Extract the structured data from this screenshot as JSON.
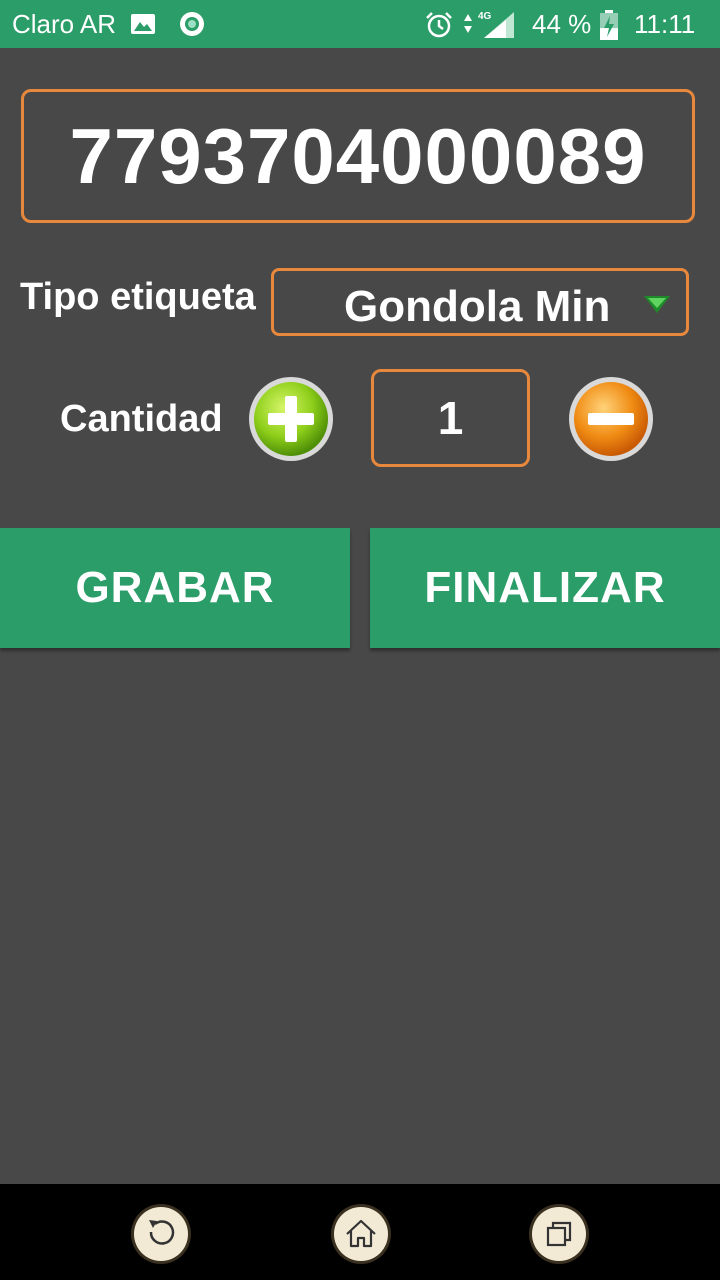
{
  "status_bar": {
    "carrier": "Claro AR",
    "network": "4G",
    "battery_percent": "44 %",
    "battery_level": 0.44,
    "time": "11:11",
    "icons": [
      "image-icon",
      "record-circle-icon",
      "alarm-icon",
      "data-signal-icon",
      "battery-charging-icon"
    ]
  },
  "barcode": {
    "value": "7793704000089"
  },
  "tipo_etiqueta": {
    "label": "Tipo etiqueta",
    "selected": "Gondola Min"
  },
  "cantidad": {
    "label": "Cantidad",
    "value": "1"
  },
  "actions": {
    "save_label": "GRABAR",
    "finish_label": "FINALIZAR"
  },
  "nav_bar": {
    "icons": [
      "back-icon",
      "home-icon",
      "recent-apps-icon"
    ]
  },
  "colors": {
    "accent_green": "#2a9d68",
    "border_orange": "#e8883c",
    "background": "#484848",
    "plus_button": "#8ecf1a",
    "minus_button": "#f08c14"
  }
}
